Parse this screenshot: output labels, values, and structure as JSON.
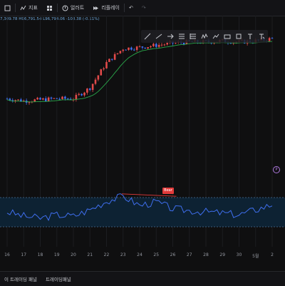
{
  "toolbar": {
    "items": [
      {
        "icon": "layout-icon",
        "label": ""
      },
      {
        "icon": "indicator-icon",
        "label": "지표"
      },
      {
        "icon": "grid-icon",
        "label": ""
      },
      {
        "icon": "alert-icon",
        "label": "얼러트"
      },
      {
        "icon": "replay-icon",
        "label": "리플레이"
      }
    ]
  },
  "ohlc_text": "7,309.78  H96,791.54  L96,794.06  -108.38 (-0.11%)",
  "drawing_tools": [
    "brush-icon",
    "line-icon",
    "arrow-icon",
    "ruler-icon",
    "fib-icon",
    "pattern-icon",
    "measure-icon",
    "rect-icon",
    "circle-icon",
    "text-icon",
    "note-icon"
  ],
  "rsi_label": "Bear",
  "marker_label": "P",
  "colors": {
    "up": "#e24a4a",
    "down": "#3f6ff0",
    "ma": "#2aa84a",
    "rsi": "#3f6ff0",
    "rsi_fill": "#0d2233",
    "bg": "#0f0f10"
  },
  "x_axis_ticks": [
    "16",
    "17",
    "18",
    "19",
    "20",
    "21",
    "22",
    "23",
    "24",
    "25",
    "26",
    "27",
    "28",
    "29",
    "30",
    "5월",
    "2"
  ],
  "bottom_tabs": [
    "이 트레이딩 패널",
    "트레이딩패널"
  ],
  "chart_data": {
    "type": "candlestick",
    "x": [
      "16",
      "17",
      "18",
      "19",
      "20",
      "21",
      "22",
      "23",
      "24",
      "25",
      "26",
      "27",
      "28",
      "29",
      "30",
      "5월",
      "2"
    ],
    "close_levels": [
      0.22,
      0.2,
      0.21,
      0.22,
      0.22,
      0.32,
      0.55,
      0.68,
      0.69,
      0.71,
      0.73,
      0.74,
      0.74,
      0.75,
      0.74,
      0.75,
      0.77
    ],
    "rsi_levels": [
      0.55,
      0.45,
      0.4,
      0.48,
      0.45,
      0.6,
      0.8,
      0.92,
      0.7,
      0.78,
      0.62,
      0.58,
      0.55,
      0.52,
      0.48,
      0.6,
      0.72
    ]
  }
}
